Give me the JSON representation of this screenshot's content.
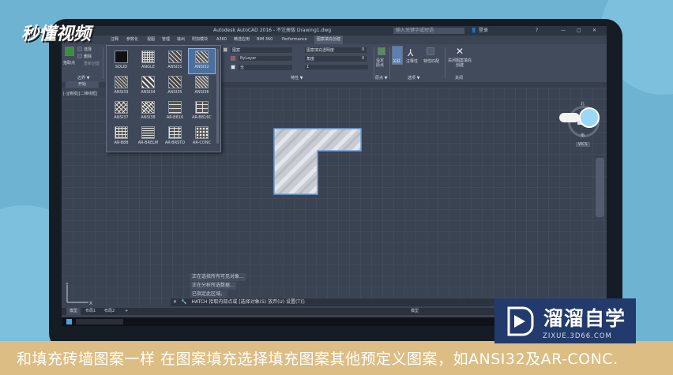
{
  "watermark_logo": "秒懂视频",
  "window_title": "Autodesk AutoCAD 2016 - 不注册版    Drawing1.dwg",
  "search_placeholder": "输入关键字或短语",
  "signin_label": "登录",
  "menu_tabs": [
    "注释",
    "参数化",
    "视图",
    "管理",
    "输出",
    "附加模块",
    "A360",
    "精选应用",
    "BIM 360",
    "Performance",
    "图案填充创建"
  ],
  "ribbon": {
    "select_label": "选择",
    "remove_label": "删除",
    "pick_points_label": "拾取点",
    "recreate_label": "重新创建",
    "boundary_panel": "边界 ▼",
    "pattern_type": "图案",
    "transparency_label": "图案填充透明度",
    "transparency_value": "0",
    "color_value": "ByLayer",
    "angle_label": "角度",
    "angle_value": "0",
    "bg_value": "无",
    "scale_value": "1",
    "properties_panel": "特性 ▼",
    "set_origin_label": "设定原点",
    "origin_panel": "原点 ▼",
    "associative_label": "关联",
    "annotative_label": "注释性",
    "match_props_label": "特性匹配",
    "options_panel": "选项 ▼",
    "close_label": "关闭图案填充创建",
    "close_panel": "关闭"
  },
  "start_tab": "开始",
  "viewport_label": "[-][俯视][二维线框]",
  "patterns": [
    "SOLID",
    "ANGLE",
    "ANSI31",
    "ANSI32",
    "ANSI33",
    "ANSI34",
    "ANSI35",
    "ANSI36",
    "ANSI37",
    "ANSI38",
    "AR-B816",
    "AR-B816C",
    "AR-B88",
    "AR-BRELM",
    "AR-BRSTD",
    "AR-CONC"
  ],
  "selected_pattern": "ANSI32",
  "nav": {
    "north": "北",
    "south": "南",
    "west": "西",
    "east": "东",
    "top": "上",
    "wcs": "WCS"
  },
  "command_history": [
    "正在选择所有可见对象...",
    "正在分析所选数据...",
    "已指定此区域。"
  ],
  "command_prompt": "HATCH 拾取内部点或 [选择对象(S) 放弃(U) 设置(T)]:",
  "layout_tabs": [
    "模型",
    "布局1",
    "布局2"
  ],
  "status_model": "模型",
  "caption": "和填充砖墙图案一样 在图案填充选择填充图案其他预定义图案，如ANSI32及AR-CONC.",
  "brand_title": "溜溜自学",
  "brand_url": "ZIXUE.3D66.COM"
}
